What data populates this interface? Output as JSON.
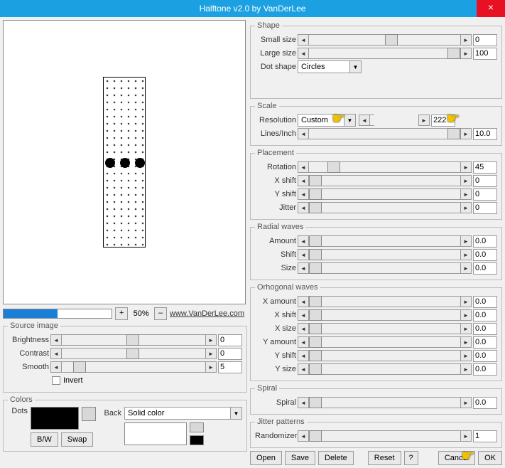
{
  "window": {
    "title": "Halftone v2.0 by VanDerLee"
  },
  "zoom": {
    "percent": "50%",
    "plus": "+",
    "minus": "–"
  },
  "url": "www.VanDerLee.com",
  "source_image": {
    "legend": "Source image",
    "brightness": {
      "label": "Brightness",
      "value": "0"
    },
    "contrast": {
      "label": "Contrast",
      "value": "0"
    },
    "smooth": {
      "label": "Smooth",
      "value": "5"
    },
    "invert_label": "Invert"
  },
  "colors": {
    "legend": "Colors",
    "dots_label": "Dots",
    "back_label": "Back",
    "back_mode": "Solid color",
    "bw_label": "B/W",
    "swap_label": "Swap"
  },
  "shape": {
    "legend": "Shape",
    "small": {
      "label": "Small size",
      "value": "0"
    },
    "large": {
      "label": "Large size",
      "value": "100"
    },
    "dotshape_label": "Dot shape",
    "dotshape_value": "Circles"
  },
  "scale": {
    "legend": "Scale",
    "resolution_label": "Resolution",
    "resolution_value": "Custom",
    "resolution_num": "222",
    "lpi": {
      "label": "Lines/Inch",
      "value": "10.0"
    }
  },
  "placement": {
    "legend": "Placement",
    "rotation": {
      "label": "Rotation",
      "value": "45"
    },
    "xshift": {
      "label": "X shift",
      "value": "0"
    },
    "yshift": {
      "label": "Y shift",
      "value": "0"
    },
    "jitter": {
      "label": "Jitter",
      "value": "0"
    }
  },
  "radial": {
    "legend": "Radial waves",
    "amount": {
      "label": "Amount",
      "value": "0.0"
    },
    "shift": {
      "label": "Shift",
      "value": "0.0"
    },
    "size": {
      "label": "Size",
      "value": "0.0"
    }
  },
  "ortho": {
    "legend": "Orhogonal waves",
    "xamount": {
      "label": "X amount",
      "value": "0.0"
    },
    "xshift": {
      "label": "X shift",
      "value": "0.0"
    },
    "xsize": {
      "label": "X size",
      "value": "0.0"
    },
    "yamount": {
      "label": "Y amount",
      "value": "0.0"
    },
    "yshift": {
      "label": "Y shift",
      "value": "0.0"
    },
    "ysize": {
      "label": "Y size",
      "value": "0.0"
    }
  },
  "spiral": {
    "legend": "Spiral",
    "spiral": {
      "label": "Spiral",
      "value": "0.0"
    }
  },
  "jitterp": {
    "legend": "Jitter patterns",
    "randomizer": {
      "label": "Randomizer",
      "value": "1"
    }
  },
  "buttons": {
    "open": "Open",
    "save": "Save",
    "delete": "Delete",
    "reset": "Reset",
    "help": "?",
    "cancel": "Cancel",
    "ok": "OK"
  }
}
